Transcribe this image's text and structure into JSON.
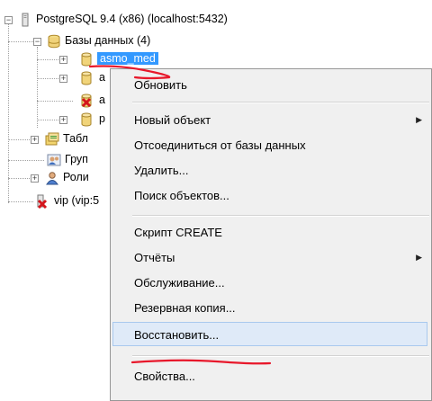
{
  "tree": {
    "server": "PostgreSQL 9.4 (x86) (localhost:5432)",
    "databases_folder": "Базы данных (4)",
    "db_selected": "asmo_med",
    "db_2": "a",
    "db_3": "a",
    "db_4": "p",
    "tablespaces": "Табл",
    "groups": "Груп",
    "roles": "Роли",
    "server_2": "vip (vip:5"
  },
  "context_menu": {
    "items": [
      {
        "label": "Обновить",
        "submenu": false
      },
      {
        "label": "Новый объект",
        "submenu": true
      },
      {
        "label": "Отсоединиться от базы данных",
        "submenu": false
      },
      {
        "label": "Удалить...",
        "submenu": false
      },
      {
        "label": "Поиск объектов...",
        "submenu": false
      },
      {
        "label": "Скрипт CREATE",
        "submenu": false
      },
      {
        "label": "Отчёты",
        "submenu": true
      },
      {
        "label": "Обслуживание...",
        "submenu": false
      },
      {
        "label": "Резервная копия...",
        "submenu": false
      },
      {
        "label": "Восстановить...",
        "submenu": false
      },
      {
        "label": "Свойства...",
        "submenu": false
      }
    ],
    "hovered_item": "Восстановить...",
    "submenu_arrow": "▶"
  },
  "colors": {
    "selection": "#3399ff",
    "annotation": "#e8182b",
    "menu_bg": "#f0f0f0",
    "hover_bg": "#dfeaf8"
  },
  "icons": [
    "server-icon",
    "database-folder-icon",
    "database-icon",
    "database-disconnected-icon",
    "tablespace-icon",
    "group-icon",
    "role-icon",
    "server-error-icon"
  ]
}
